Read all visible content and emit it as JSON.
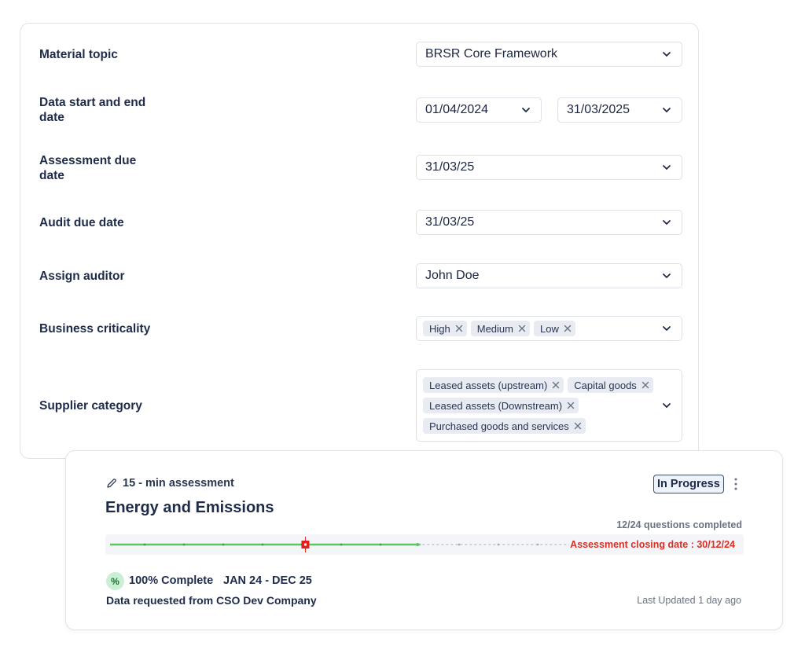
{
  "form": {
    "material_topic": {
      "label": "Material topic",
      "value": "BRSR Core Framework"
    },
    "data_dates": {
      "label": "Data start and end date",
      "start": "01/04/2024",
      "end": "31/03/2025"
    },
    "assessment_due": {
      "label": "Assessment due date",
      "value": "31/03/25"
    },
    "audit_due": {
      "label": "Audit due date",
      "value": "31/03/25"
    },
    "auditor": {
      "label": "Assign auditor",
      "value": "John Doe"
    },
    "criticality": {
      "label": "Business criticality",
      "tags": [
        "High",
        "Medium",
        "Low"
      ]
    },
    "supplier": {
      "label": "Supplier category",
      "tags": [
        "Leased assets (upstream)",
        "Capital goods",
        "Leased assets (Downstream)",
        "Purchased goods and services"
      ]
    }
  },
  "assessment": {
    "duration_label": "15 - min assessment",
    "title": "Energy and Emissions",
    "status": "In Progress",
    "questions_completed": "12/24 questions completed",
    "progress_fraction": 0.5,
    "closing_date": "Assessment closing date : 30/12/24",
    "percent_symbol": "%",
    "complete_text": "100% Complete",
    "date_range": "JAN 24 - DEC 25",
    "requested_from": "Data requested from CSO Dev Company",
    "last_updated": "Last Updated 1 day ago"
  },
  "colors": {
    "progress_done": "#5cc75f",
    "progress_remaining": "#b8bec9",
    "marker": "#e02020",
    "closing_text": "#d93025"
  }
}
